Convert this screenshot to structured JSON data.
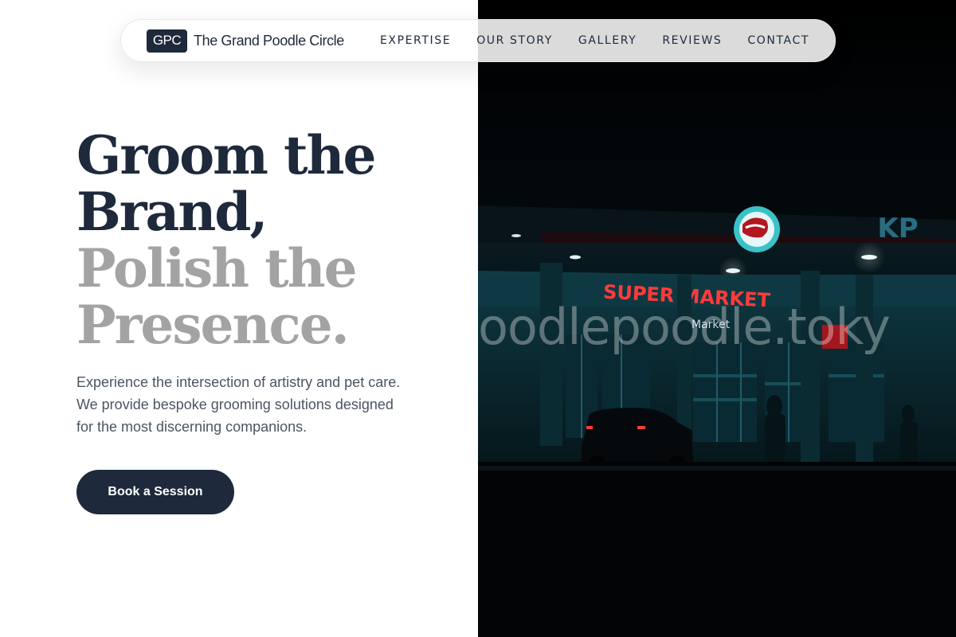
{
  "brand": {
    "badge": "GPC",
    "name": "The Grand Poodle Circle"
  },
  "nav": {
    "items": [
      "EXPERTISE",
      "OUR STORY",
      "GALLERY",
      "REVIEWS",
      "CONTACT"
    ]
  },
  "hero": {
    "headline_dark": [
      "Groom the",
      "Brand,"
    ],
    "headline_light": [
      "Polish the",
      "Presence."
    ],
    "subtext": "Experience the intersection of artistry and pet care. We provide bespoke grooming solutions designed for the most discerning companions.",
    "cta_label": "Book a Session"
  },
  "photo": {
    "watermark": "oodlepoodle.toky",
    "sign_text": "SUPER MARKET",
    "sub_sign": "Market",
    "corner_sign": "KP"
  },
  "colors": {
    "primary": "#1e293b",
    "muted_heading": "#a3a3a3",
    "body_text": "#4b5563",
    "background": "#ffffff"
  }
}
